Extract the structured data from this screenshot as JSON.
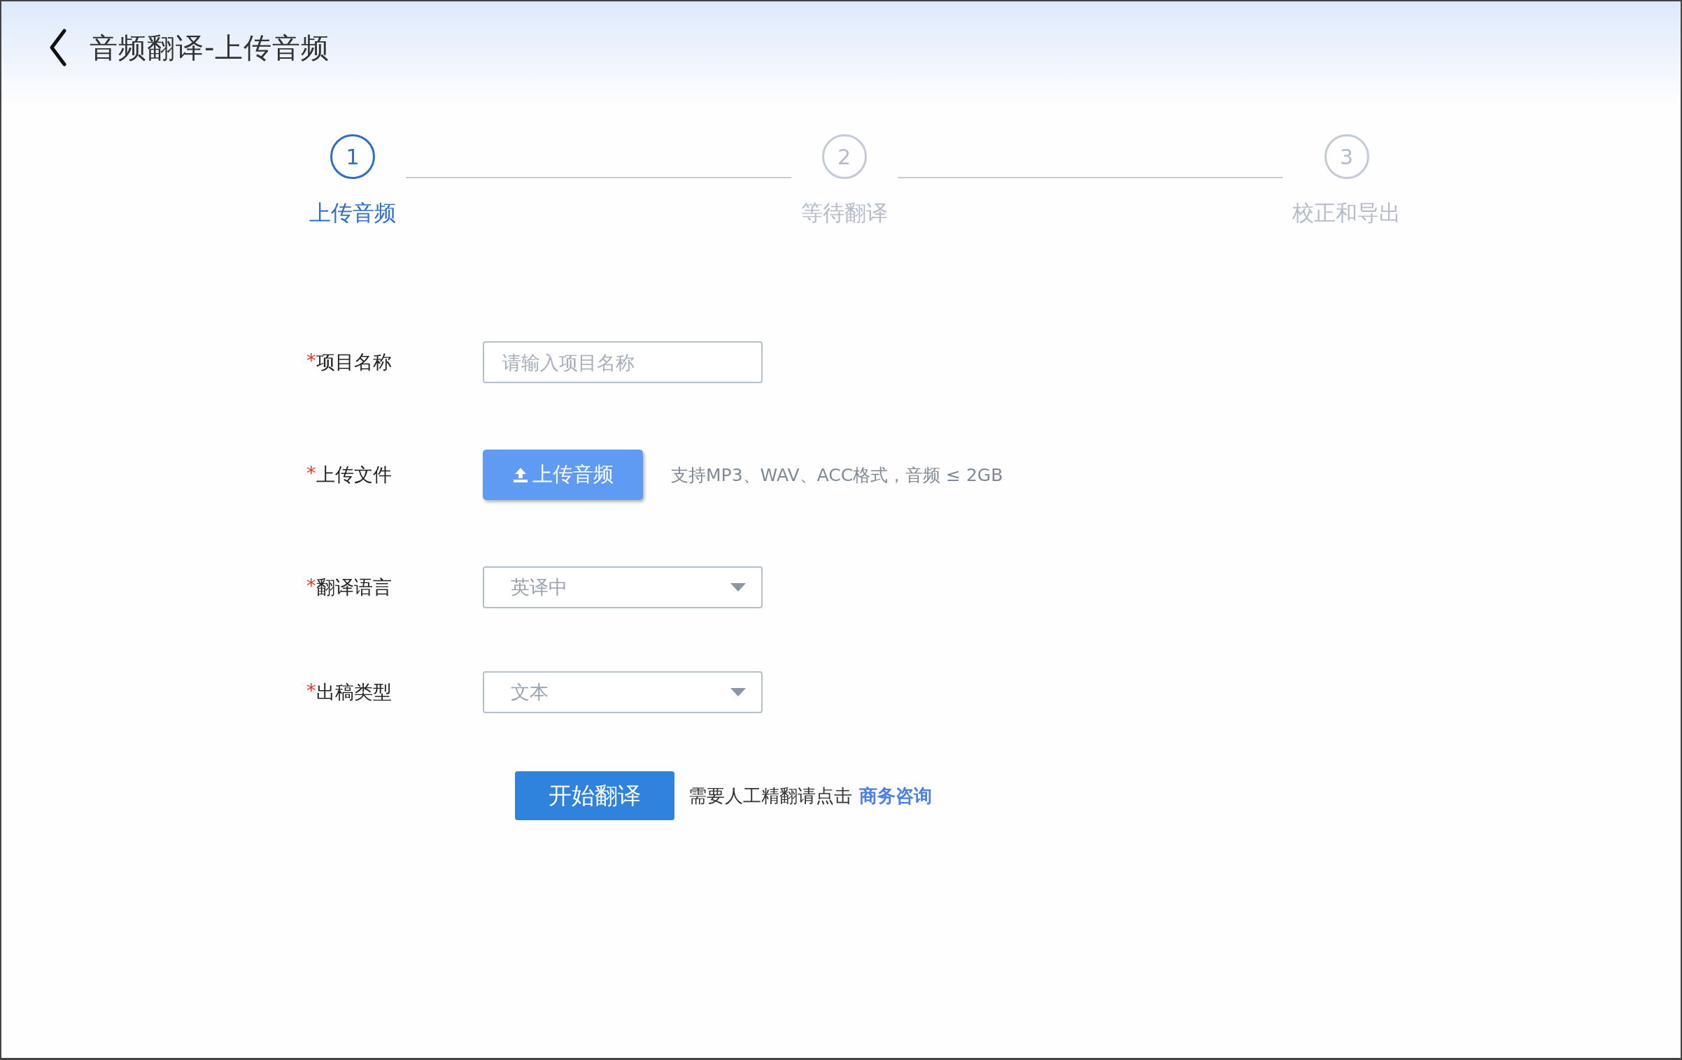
{
  "header": {
    "title": "音频翻译-上传音频"
  },
  "steps": [
    {
      "number": "1",
      "label": "上传音频",
      "selected": true
    },
    {
      "number": "2",
      "label": "等待翻译",
      "selected": false
    },
    {
      "number": "3",
      "label": "校正和导出",
      "selected": false
    }
  ],
  "form": {
    "fields": [
      {
        "kind": "input",
        "required_mark": "*",
        "label": "项目名称",
        "placeholder": "请输入项目名称"
      },
      {
        "kind": "upload",
        "required_mark": "*",
        "label": "上传文件",
        "button": "上传音频",
        "hint": "支持MP3、WAV、ACC格式，音频 ≤ 2GB"
      },
      {
        "kind": "select",
        "required_mark": "*",
        "label": "翻译语言",
        "value": "英译中"
      },
      {
        "kind": "select",
        "required_mark": "*",
        "label": "出稿类型",
        "value": "文本"
      }
    ]
  },
  "footer": {
    "button": "开始翻译",
    "note": "需要人工精翻请点击",
    "link": "商务咨询"
  }
}
